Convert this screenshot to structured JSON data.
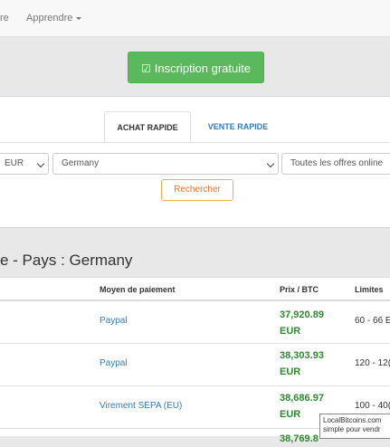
{
  "nav": {
    "item_partial": "re",
    "learn": "Apprendre"
  },
  "hero": {
    "signup_label": "Inscription gratuite"
  },
  "tabs": {
    "buy": "ACHAT RAPIDE",
    "sell": "VENTE RAPIDE"
  },
  "form": {
    "currency": "EUR",
    "country": "Germany",
    "offers": "Toutes les offres online",
    "search_label": "Rechercher"
  },
  "heading": "e - Pays : Germany",
  "table": {
    "headers": {
      "payment": "Moyen de paiement",
      "price": "Prix / BTC",
      "limits": "Limites"
    },
    "rows": [
      {
        "payment": "Paypal",
        "price_amount": "37,920.89",
        "price_currency": "EUR",
        "limits": "60 - 66 E"
      },
      {
        "payment": "Paypal",
        "price_amount": "38,303.93",
        "price_currency": "EUR",
        "limits": "120 - 12("
      },
      {
        "payment": "Virement SEPA (EU)",
        "price_amount": "38,686.97",
        "price_currency": "EUR",
        "limits": "100 - 40("
      },
      {
        "payment": "",
        "price_amount": "38,769.8",
        "price_currency": "",
        "limits": ""
      }
    ]
  },
  "tooltip": {
    "line1": "LocalBitcoins.com",
    "line2": "simple pour vendr"
  }
}
